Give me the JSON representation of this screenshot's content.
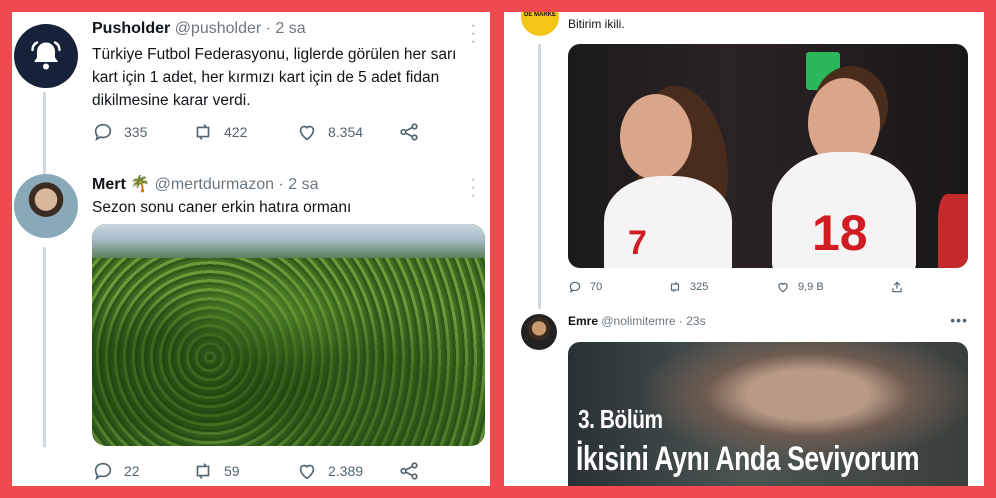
{
  "colors": {
    "frame": "#f04a4f",
    "text": "#0f1419",
    "muted": "#53646f",
    "line": "#cfd9de",
    "brand_yellow": "#f4c518"
  },
  "left": {
    "tweet1": {
      "name": "Pusholder",
      "meta": "@pusholder · 2 sa",
      "text": "Türkiye Futbol Federasyonu, liglerde görülen her sarı kart için 1 adet, her kırmızı kart için de 5 adet fidan dikilmesine karar verdi.",
      "replies": "335",
      "retweets": "422",
      "likes": "8.354",
      "avatar_icon": "bell-icon"
    },
    "tweet2": {
      "name": "Mert 🌴",
      "meta": "@mertdurmazon · 2 sa",
      "text": "Sezon sonu caner erkin hatıra ormanı",
      "replies": "22",
      "retweets": "59",
      "likes": "2.389"
    }
  },
  "right": {
    "tweet1": {
      "avatar_label": "DE MARKE",
      "text": "Bitirim ikili.",
      "replies": "70",
      "retweets": "325",
      "likes": "9,9 B",
      "jersey_left": "7",
      "jersey_right": "18"
    },
    "tweet2": {
      "name": "Emre",
      "meta": "@nolimitemre · 23s",
      "image_title_1": "3. Bölüm",
      "image_title_2": "İkisini Aynı Anda Seviyorum"
    }
  }
}
